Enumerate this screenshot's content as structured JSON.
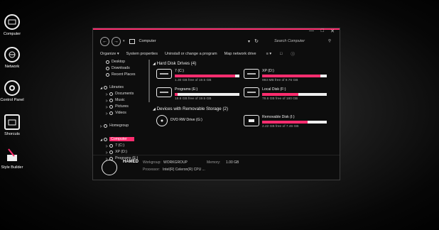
{
  "desktop": {
    "icons": [
      {
        "label": "Computer",
        "icon": "computer-icon"
      },
      {
        "label": "Network",
        "icon": "network-icon"
      },
      {
        "label": "Control Panel",
        "icon": "control-panel-icon"
      },
      {
        "label": "Shorcuts",
        "icon": "shortcuts-icon"
      },
      {
        "label": "Style Builder",
        "icon": "style-builder-icon"
      }
    ]
  },
  "window": {
    "address": "Computer",
    "search_placeholder": "Search Computer",
    "toolbar": {
      "organize": "Organize",
      "system_properties": "System properties",
      "uninstall": "Uninstall or change a program",
      "map_drive": "Map network drive"
    },
    "nav": {
      "favorites": [
        "Desktop",
        "Downloads",
        "Recent Places"
      ],
      "libraries": "Libraries",
      "library_items": [
        "Documents",
        "Music",
        "Pictures",
        "Videos"
      ],
      "homegroup": "Homegroup",
      "computer": "Computer",
      "computer_items": [
        "7 (C:)",
        "XP (D:)",
        "Programs (E:)"
      ]
    },
    "hard_disks_header": "Hard Disk Drives (4)",
    "hard_disks": [
      {
        "name": "7 (C:)",
        "free": "1.30 GB free of 19.5 GB",
        "used_fraction": 0.93
      },
      {
        "name": "XP (D:)",
        "free": "993 MB free of 9.76 GB",
        "used_fraction": 0.9
      },
      {
        "name": "Programs (E:)",
        "free": "18.8 GB free of 19.5 GB",
        "used_fraction": 0.04
      },
      {
        "name": "Local Disk (F:)",
        "free": "78.6 GB free of 180 GB",
        "used_fraction": 0.56
      }
    ],
    "removable_header": "Devices with Removable Storage (2)",
    "removable": [
      {
        "name": "DVD RW Drive (G:)"
      },
      {
        "name": "Removable Disk (I:)",
        "free": "2.22 GB free of 7.46 GB",
        "used_fraction": 0.7
      }
    ],
    "details": {
      "name": "HAMED",
      "workgroup_label": "Workgroup:",
      "workgroup": "WORKGROUP",
      "memory_label": "Memory:",
      "memory": "1.00 GB",
      "processor_label": "Processor:",
      "processor": "Intel(R) Celeron(R) CPU ..."
    },
    "accent": "#ff2d6f"
  }
}
